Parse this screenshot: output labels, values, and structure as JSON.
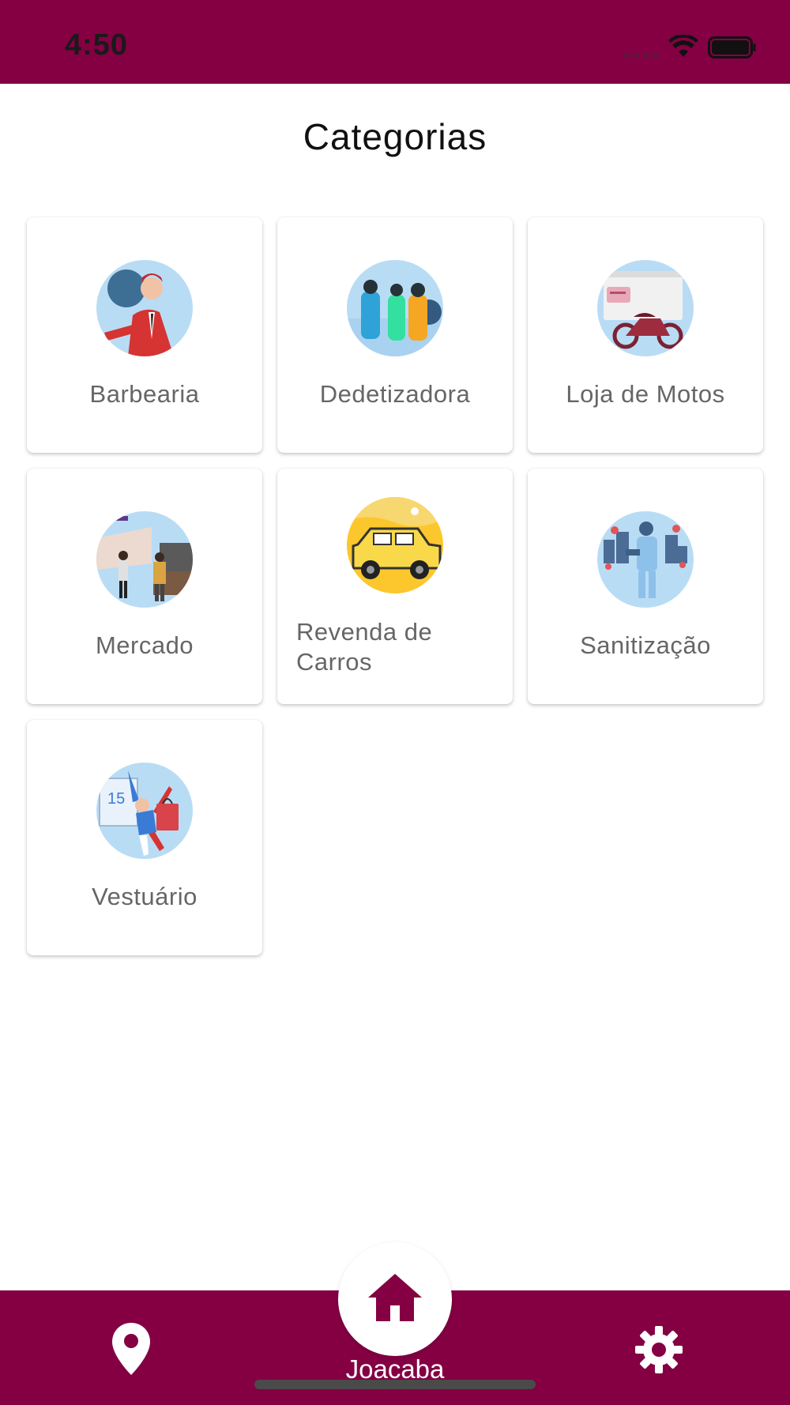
{
  "status_bar": {
    "time": "4:50"
  },
  "header": {
    "title": "Categorias"
  },
  "categories": [
    {
      "label": "Barbearia",
      "icon": "barber-illustration-icon"
    },
    {
      "label": "Dedetizadora",
      "icon": "pest-control-illustration-icon"
    },
    {
      "label": "Loja de Motos",
      "icon": "motorcycle-shop-illustration-icon"
    },
    {
      "label": "Mercado",
      "icon": "market-illustration-icon"
    },
    {
      "label": "Revenda de Carros",
      "icon": "car-resale-illustration-icon"
    },
    {
      "label": "Sanitização",
      "icon": "sanitization-illustration-icon"
    },
    {
      "label": "Vestuário",
      "icon": "clothing-illustration-icon"
    }
  ],
  "bottom_nav": {
    "home_label": "Joacaba",
    "items": [
      "location-icon",
      "home-icon",
      "gear-icon"
    ]
  },
  "colors": {
    "brand": "#840043",
    "thumb_bg": "#b9dcf5",
    "card_bg": "#ffffff",
    "label_text": "#666666"
  }
}
